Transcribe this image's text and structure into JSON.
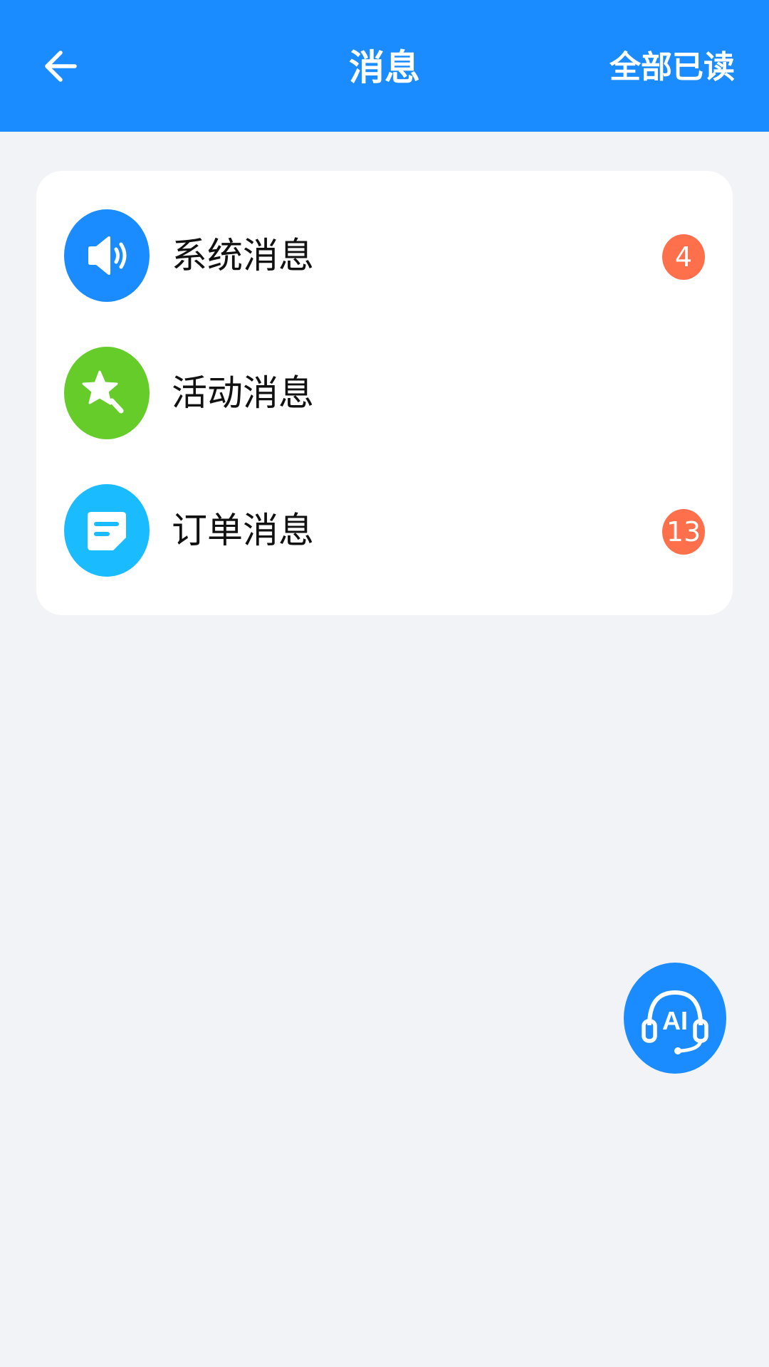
{
  "header": {
    "title": "消息",
    "mark_all_read_label": "全部已读",
    "back_icon": "arrow-left-icon",
    "background_color": "#1a8cff"
  },
  "messages": [
    {
      "label": "系统消息",
      "icon": "speaker-icon",
      "icon_color": "#1a8cff",
      "badge": "4"
    },
    {
      "label": "活动消息",
      "icon": "star-wand-icon",
      "icon_color": "#66cc2a",
      "badge": ""
    },
    {
      "label": "订单消息",
      "icon": "order-note-icon",
      "icon_color": "#1bbcff",
      "badge": "13"
    }
  ],
  "badge_color": "#fe6f4c",
  "ai_button": {
    "text": "AI",
    "icon": "ai-headset-icon",
    "color": "#1a8cff"
  }
}
